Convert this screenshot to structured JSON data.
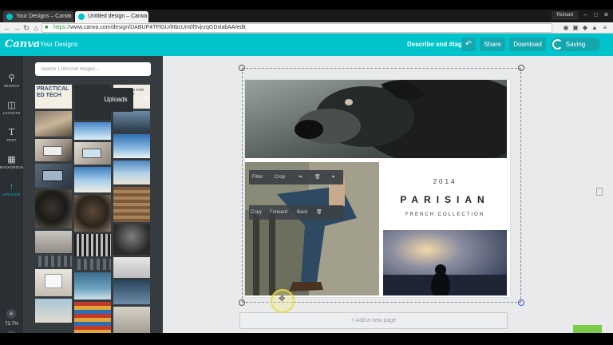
{
  "browser": {
    "tabs": [
      {
        "title": "Your Designs – Canva"
      },
      {
        "title": "Untitled design – Canva"
      }
    ],
    "profile": "Richard",
    "url_scheme": "https://",
    "url_rest": "www.canva.com/design/DABUP4TFlGU/8tbcUm0l5vjrzqGDxlabAA/edit"
  },
  "header": {
    "logo": "Canva",
    "your_designs": "Your Designs",
    "describe": "Describe and #tag",
    "share": "Share",
    "download": "Download",
    "saving": "Saving",
    "accent_color": "#00c4cc"
  },
  "rail": {
    "items": [
      {
        "label": "SEARCH",
        "icon": "search-icon"
      },
      {
        "label": "LAYOUTS",
        "icon": "layouts-icon"
      },
      {
        "label": "TEXT",
        "icon": "text-icon"
      },
      {
        "label": "BACKGROUND",
        "icon": "background-icon"
      },
      {
        "label": "UPLOADS",
        "icon": "uploads-icon"
      }
    ],
    "zoom": "73.7%"
  },
  "panel": {
    "search_placeholder": "Search 1,000,000 images...",
    "uploads_popup": "Uploads",
    "thumb_text": "PRACTICAL ED TECH",
    "thumb_text_2": "FREE TECH FOR TEACHERS"
  },
  "design": {
    "year": "2014",
    "title": "PARISIAN",
    "subtitle": "FRENCH COLLECTION"
  },
  "context_menu_1": {
    "filter": "Filter",
    "crop": "Crop"
  },
  "context_menu_2": {
    "copy": "Copy",
    "forward": "Forward",
    "back": "Back"
  },
  "add_page": "+ Add a new page"
}
